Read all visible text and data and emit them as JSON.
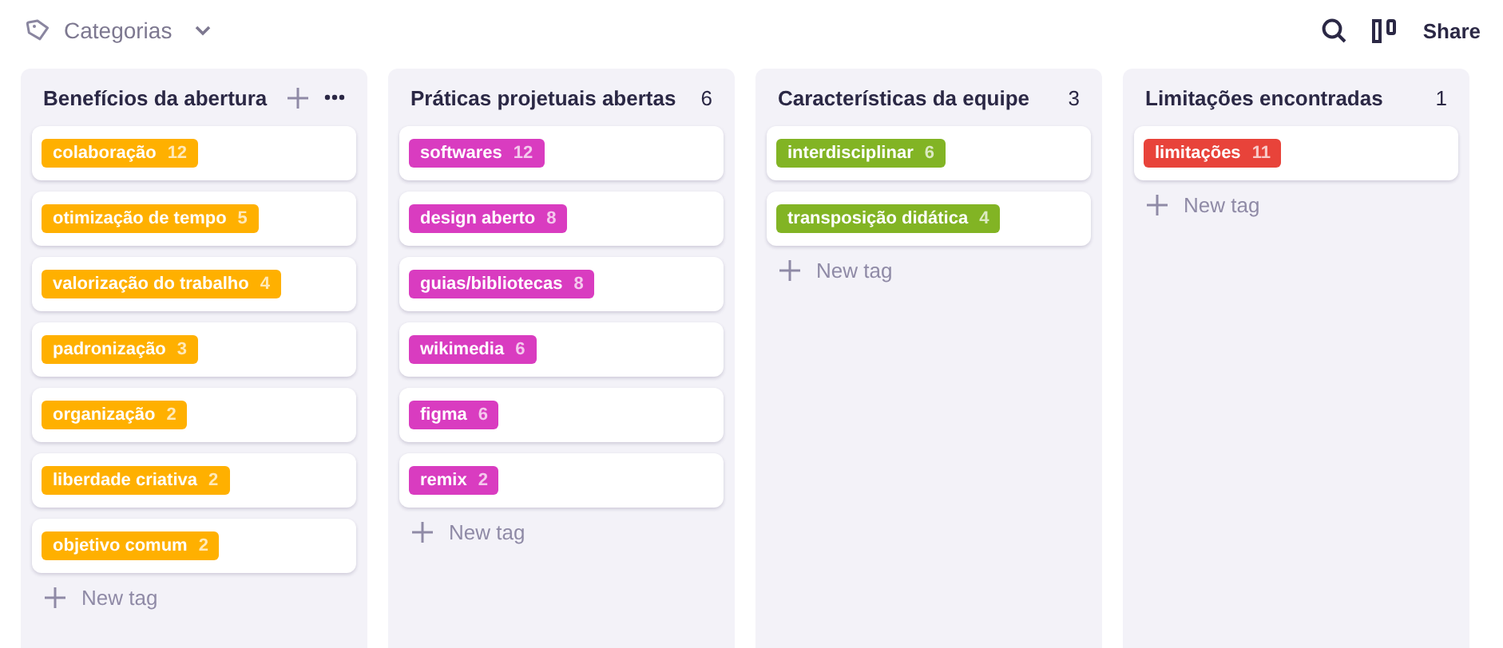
{
  "toolbar": {
    "title": "Categorias",
    "share": "Share"
  },
  "columns": [
    {
      "title": "Benefícios da abertura",
      "show_actions": true,
      "color": "#ffb000",
      "tags": [
        {
          "name": "colaboração",
          "count": "12"
        },
        {
          "name": "otimização de tempo",
          "count": "5"
        },
        {
          "name": "valorização do trabalho",
          "count": "4"
        },
        {
          "name": "padronização",
          "count": "3"
        },
        {
          "name": "organização",
          "count": "2"
        },
        {
          "name": "liberdade criativa",
          "count": "2"
        },
        {
          "name": "objetivo comum",
          "count": "2"
        }
      ],
      "new_tag": "New tag"
    },
    {
      "title": "Práticas projetuais abertas",
      "count": "6",
      "color": "#d93cc0",
      "tags": [
        {
          "name": "softwares",
          "count": "12"
        },
        {
          "name": "design aberto",
          "count": "8"
        },
        {
          "name": "guias/bibliotecas",
          "count": "8"
        },
        {
          "name": "wikimedia",
          "count": "6"
        },
        {
          "name": "figma",
          "count": "6"
        },
        {
          "name": "remix",
          "count": "2"
        }
      ],
      "new_tag": "New tag"
    },
    {
      "title": "Características da equipe",
      "count": "3",
      "color": "#82b424",
      "tags": [
        {
          "name": "interdisciplinar",
          "count": "6"
        },
        {
          "name": "transposição didática",
          "count": "4"
        }
      ],
      "new_tag": "New tag"
    },
    {
      "title": "Limitações encontradas",
      "count": "1",
      "color": "#e8433a",
      "tags": [
        {
          "name": "limitações",
          "count": "11"
        }
      ],
      "new_tag": "New tag"
    }
  ]
}
